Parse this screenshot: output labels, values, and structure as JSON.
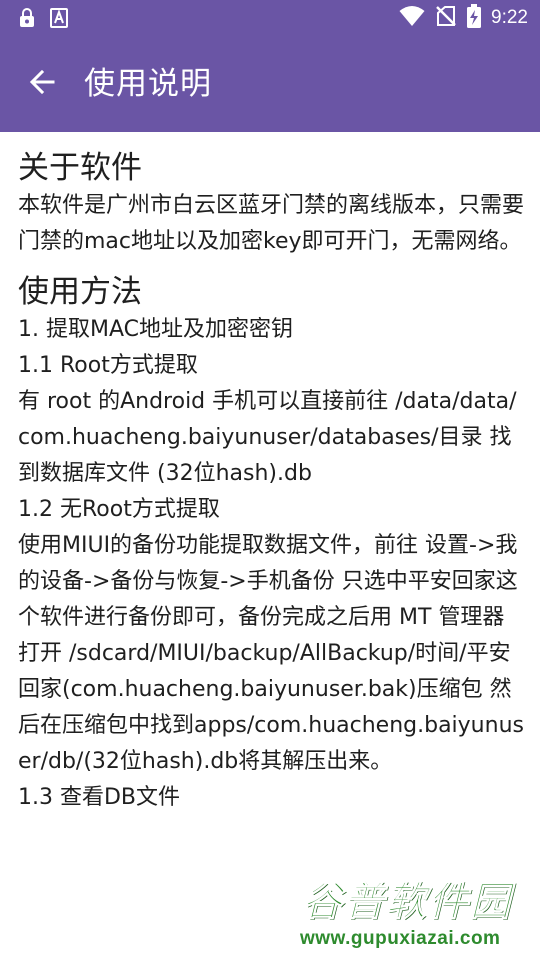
{
  "status_bar": {
    "time": "9:22",
    "icons_left": [
      "lock-badge-icon",
      "font-a-icon"
    ],
    "icons_right": [
      "wifi-icon",
      "no-sim-icon",
      "battery-charging-icon"
    ]
  },
  "app_bar": {
    "title": "使用说明",
    "back_icon": "arrow-left-icon",
    "color": "#6a55a5"
  },
  "content": {
    "about_title": "关于软件",
    "about_text": "本软件是广州市白云区蓝牙门禁的离线版本，只需要门禁的mac地址以及加密key即可开门，无需网络。",
    "usage_title": "使用方法",
    "step_1": "1. 提取MAC地址及加密密钥",
    "step_1_1_title": "1.1 Root方式提取",
    "step_1_1_text": "有 root 的Android 手机可以直接前往 /data/data/com.huacheng.baiyunuser/databases/目录 找到数据库文件 (32位hash).db",
    "step_1_2_title": "1.2 无Root方式提取",
    "step_1_2_text": "使用MIUI的备份功能提取数据文件，前往 设置->我的设备->备份与恢复->手机备份 只选中平安回家这个软件进行备份即可，备份完成之后用 MT 管理器打开 /sdcard/MIUI/backup/AllBackup/时间/平安回家(com.huacheng.baiyunuser.bak)压缩包 然后在压缩包中找到apps/com.huacheng.baiyunuser/db/(32位hash).db将其解压出来。",
    "step_1_3_title": "1.3 查看DB文件"
  },
  "watermark": {
    "title": "谷普软件园",
    "url": "www.gupuxiazai.com"
  }
}
